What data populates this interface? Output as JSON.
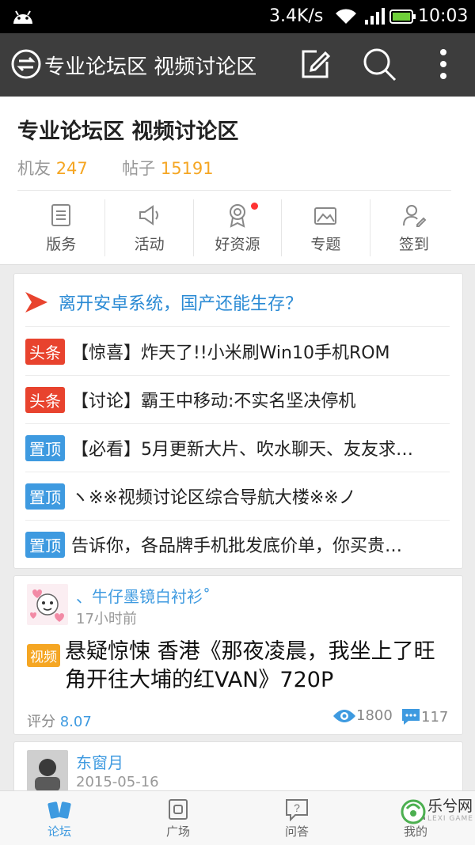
{
  "status_bar": {
    "speed": "3.4K/s",
    "time": "10:03"
  },
  "app_bar": {
    "title": "专业论坛区 视频讨论区"
  },
  "forum": {
    "name": "专业论坛区 视频讨论区",
    "members_label": "机友",
    "members_count": "247",
    "posts_label": "帖子",
    "posts_count": "15191",
    "quick_links": [
      {
        "label": "版务",
        "icon": "document-icon"
      },
      {
        "label": "活动",
        "icon": "megaphone-icon"
      },
      {
        "label": "好资源",
        "icon": "award-icon"
      },
      {
        "label": "专题",
        "icon": "picture-icon"
      },
      {
        "label": "签到",
        "icon": "user-sign-icon"
      }
    ]
  },
  "pinned": {
    "featured": "离开安卓系统，国产还能生存？",
    "items": [
      {
        "tag": "头条",
        "tag_color": "#e8432e",
        "text": "【惊喜】炸天了!!小米刷Win10手机ROM"
      },
      {
        "tag": "头条",
        "tag_color": "#e8432e",
        "text": "【讨论】霸王中移动:不实名坚决停机"
      },
      {
        "tag": "置顶",
        "tag_color": "#3e9ae0",
        "text": "【必看】5月更新大片、吹水聊天、友友求…"
      },
      {
        "tag": "置顶",
        "tag_color": "#3e9ae0",
        "text": "ヽ※※视频讨论区综合导航大楼※※ノ"
      },
      {
        "tag": "置顶",
        "tag_color": "#3e9ae0",
        "text": "告诉你，各品牌手机批发底价单，你买贵…"
      }
    ]
  },
  "post": {
    "author": "、牛仔墨镜白衬衫˚",
    "time": "17小时前",
    "tag": "视频",
    "title": "悬疑惊悚 香港《那夜凌晨，我坐上了旺角开往大埔的红VAN》720P",
    "score_label": "评分",
    "score": "8.07",
    "views": "1800",
    "comments": "117"
  },
  "post2": {
    "author": "东窗月",
    "time": "2015-05-16"
  },
  "tabs": [
    {
      "label": "论坛",
      "active": true
    },
    {
      "label": "广场",
      "active": false
    },
    {
      "label": "问答",
      "active": false
    },
    {
      "label": "我的",
      "active": false
    }
  ],
  "watermark": {
    "text_cn": "乐兮网",
    "text_en": "LEXI GAME"
  },
  "colors": {
    "accent": "#3e9ae0",
    "orange": "#f5a623",
    "red_tag": "#e8432e",
    "appbar": "#3d3d3d"
  }
}
